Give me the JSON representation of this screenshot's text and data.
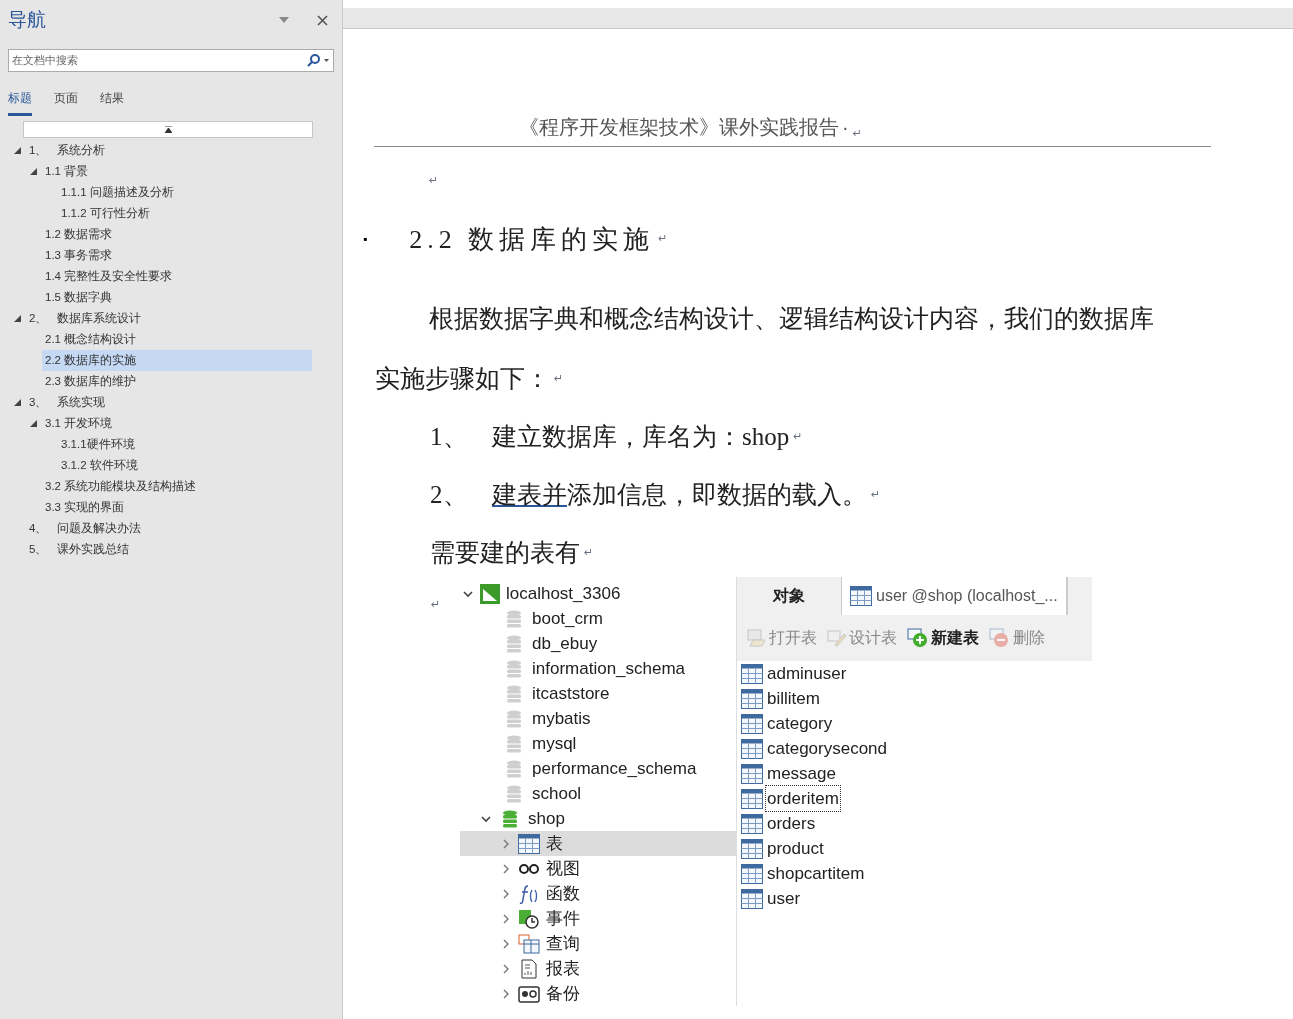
{
  "navigation": {
    "title": "导航",
    "search": {
      "placeholder": "在文档中搜索"
    },
    "tabs": [
      {
        "label": "标题",
        "selected": true
      },
      {
        "label": "页面",
        "selected": false
      },
      {
        "label": "结果",
        "selected": false
      }
    ],
    "outline": [
      {
        "number": "1、",
        "label": "系统分析",
        "expanded": true,
        "selected": false,
        "children": [
          {
            "label": "1.1 背景",
            "expanded": true,
            "selected": false,
            "children": [
              {
                "label": "1.1.1 问题描述及分析",
                "selected": false
              },
              {
                "label": "1.1.2 可行性分析",
                "selected": false
              }
            ]
          },
          {
            "label": "1.2 数据需求",
            "selected": false
          },
          {
            "label": "1.3 事务需求",
            "selected": false
          },
          {
            "label": "1.4 完整性及安全性要求",
            "selected": false
          },
          {
            "label": "1.5 数据字典",
            "selected": false
          }
        ]
      },
      {
        "number": "2、",
        "label": "数据库系统设计",
        "expanded": true,
        "selected": false,
        "children": [
          {
            "label": "2.1 概念结构设计",
            "selected": false
          },
          {
            "label": "2.2 数据库的实施",
            "selected": true
          },
          {
            "label": "2.3 数据库的维护",
            "selected": false
          }
        ]
      },
      {
        "number": "3、",
        "label": "系统实现",
        "expanded": true,
        "selected": false,
        "children": [
          {
            "label": "3.1 开发环境",
            "expanded": true,
            "selected": false,
            "children": [
              {
                "label": "3.1.1硬件环境",
                "selected": false
              },
              {
                "label": "3.1.2 软件环境",
                "selected": false
              }
            ]
          },
          {
            "label": "3.2 系统功能模块及结构描述",
            "selected": false
          },
          {
            "label": "3.3 实现的界面",
            "selected": false
          }
        ]
      },
      {
        "number": "4、",
        "label": "问题及解决办法",
        "selected": false
      },
      {
        "number": "5、",
        "label": "课外实践总结",
        "selected": false
      }
    ]
  },
  "document": {
    "header": {
      "text": "《程序开发框架技术》课外实践报告",
      "dot": "·",
      "mark": "↵"
    },
    "empty_mark": "↵",
    "heading": {
      "bullet": "▪",
      "text": "2.2 数据库的实施",
      "mark": "↵"
    },
    "paragraph": {
      "line_1": "根据数据字典和概念结构设计、逻辑结构设计内容，我们的数据库",
      "line_2": "实施步骤如下：",
      "mark": "↵"
    },
    "list": [
      {
        "number": "1、",
        "text": "建立数据库，库名为：shop",
        "mark": "↵"
      },
      {
        "number": "2、",
        "underlined": "建表并",
        "text": "添加信息，即数据的载入。",
        "mark": "↵"
      }
    ],
    "tables_intro": {
      "text": "需要建的表有",
      "mark": "↵"
    },
    "image_mark": "↵",
    "screenshot": {
      "connection": {
        "label": "localhost_3306",
        "expanded": true
      },
      "databases": [
        {
          "label": "boot_crm",
          "open": false
        },
        {
          "label": "db_ebuy",
          "open": false
        },
        {
          "label": "information_schema",
          "open": false
        },
        {
          "label": "itcaststore",
          "open": false
        },
        {
          "label": "mybatis",
          "open": false
        },
        {
          "label": "mysql",
          "open": false
        },
        {
          "label": "performance_schema",
          "open": false
        },
        {
          "label": "school",
          "open": false
        },
        {
          "label": "shop",
          "open": true,
          "expanded": true,
          "children": [
            {
              "kind": "table",
              "label": "表",
              "selected": true
            },
            {
              "kind": "view",
              "label": "视图",
              "selected": false
            },
            {
              "kind": "function",
              "label": "函数",
              "selected": false
            },
            {
              "kind": "event",
              "label": "事件",
              "selected": false
            },
            {
              "kind": "query",
              "label": "查询",
              "selected": false
            },
            {
              "kind": "report",
              "label": "报表",
              "selected": false
            },
            {
              "kind": "backup",
              "label": "备份",
              "selected": false
            }
          ]
        }
      ],
      "tabs": [
        {
          "label": "对象",
          "selected": true
        },
        {
          "label": "user @shop (localhost_...",
          "selected": false
        }
      ],
      "toolbar": [
        {
          "kind": "open",
          "label": "打开表",
          "disabled": true
        },
        {
          "kind": "design",
          "label": "设计表",
          "disabled": true
        },
        {
          "kind": "new",
          "label": "新建表",
          "disabled": false
        },
        {
          "kind": "delete",
          "label": "删除",
          "disabled": true
        }
      ],
      "tables": [
        {
          "name": "adminuser",
          "focused": false
        },
        {
          "name": "billitem",
          "focused": false
        },
        {
          "name": "category",
          "focused": false
        },
        {
          "name": "categorysecond",
          "focused": false
        },
        {
          "name": "message",
          "focused": false
        },
        {
          "name": "orderitem",
          "focused": true
        },
        {
          "name": "orders",
          "focused": false
        },
        {
          "name": "product",
          "focused": false
        },
        {
          "name": "shopcartitem",
          "focused": false
        },
        {
          "name": "user",
          "focused": false
        }
      ]
    }
  }
}
